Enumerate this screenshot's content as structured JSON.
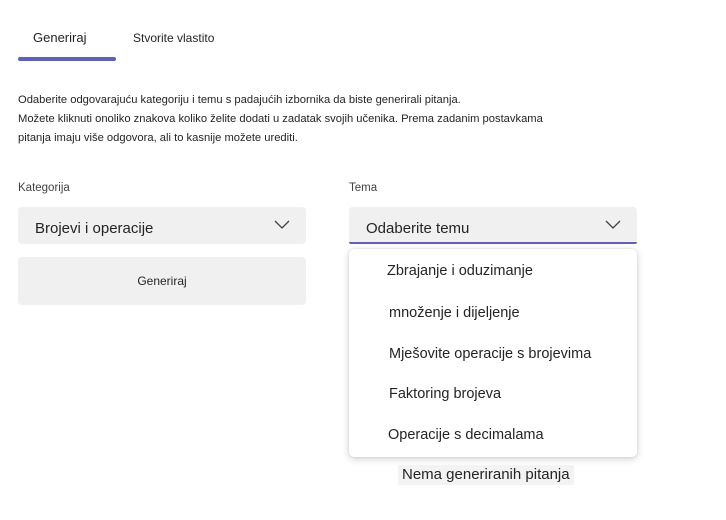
{
  "tabs": {
    "generate": "Generiraj",
    "create_own": "Stvorite vlastito"
  },
  "description": {
    "line1": "Odaberite odgovarajuću kategoriju i temu s padajućih izbornika da biste generirali pitanja.",
    "line2": "Možete kliknuti onoliko znakova koliko želite dodati u zadatak svojih učenika. Prema zadanim postavkama",
    "line3": "pitanja imaju više odgovora, ali to kasnije možete urediti."
  },
  "category": {
    "label": "Kategorija",
    "value": "Brojevi i operacije"
  },
  "topic": {
    "label": "Tema",
    "value": "Odaberite temu",
    "options": [
      "Zbrajanje i oduzimanje",
      "množenje i dijeljenje",
      "Mješovite operacije s brojevima",
      "Faktoring brojeva",
      "Operacije s decimalama"
    ]
  },
  "generate_button": "Generiraj",
  "empty_message": "Nema generiranih pitanja",
  "colors": {
    "accent": "#5b5fc7",
    "field_bg": "#f0f0f0"
  }
}
